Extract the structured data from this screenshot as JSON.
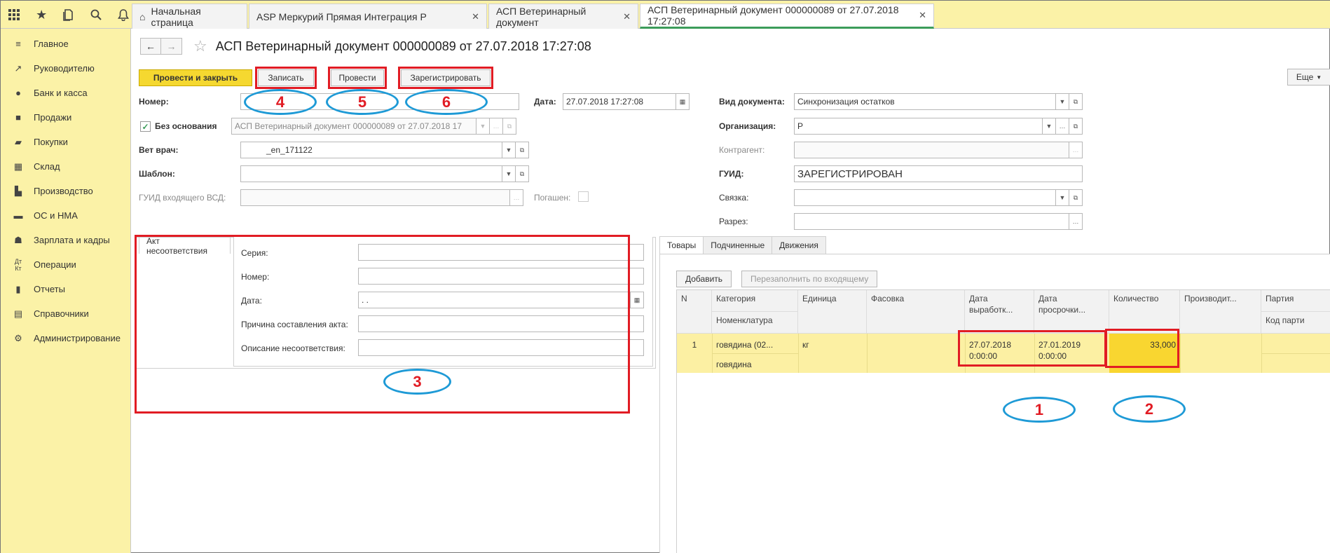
{
  "topbar": {
    "icons": [
      "apps-grid-icon",
      "star-icon",
      "history-icon",
      "search-icon",
      "bell-icon"
    ],
    "tabs": [
      {
        "label": "Начальная страница",
        "closable": false
      },
      {
        "label": "ASP Меркурий Прямая Интеграция Р",
        "closable": true
      },
      {
        "label": "АСП Ветеринарный документ",
        "closable": true
      },
      {
        "label": "АСП Ветеринарный документ 000000089 от 27.07.2018 17:27:08",
        "closable": true
      }
    ]
  },
  "sidebar": {
    "items": [
      {
        "label": "Главное",
        "icon": "menu-lines-icon"
      },
      {
        "label": "Руководителю",
        "icon": "chart-trend-icon"
      },
      {
        "label": "Банк и касса",
        "icon": "coin-icon"
      },
      {
        "label": "Продажи",
        "icon": "bag-icon"
      },
      {
        "label": "Покупки",
        "icon": "cart-icon"
      },
      {
        "label": "Склад",
        "icon": "warehouse-icon"
      },
      {
        "label": "Производство",
        "icon": "factory-icon"
      },
      {
        "label": "ОС и НМА",
        "icon": "truck-icon"
      },
      {
        "label": "Зарплата и кадры",
        "icon": "person-icon"
      },
      {
        "label": "Операции",
        "icon": "debit-credit-icon"
      },
      {
        "label": "Отчеты",
        "icon": "bar-chart-icon"
      },
      {
        "label": "Справочники",
        "icon": "book-icon"
      },
      {
        "label": "Администрирование",
        "icon": "gear-icon"
      }
    ]
  },
  "header": {
    "title": "АСП Ветеринарный документ 000000089 от 27.07.2018 17:27:08"
  },
  "toolbar": {
    "post_close": "Провести и закрыть",
    "save": "Записать",
    "post": "Провести",
    "register": "Зарегистрировать",
    "more": "Еще"
  },
  "form": {
    "number_label": "Номер:",
    "date_label": "Дата:",
    "date_value": "27.07.2018 17:27:08",
    "no_basis_label": "Без основания",
    "basis_value": "АСП Ветеринарный документ 000000089 от 27.07.2018 17",
    "vet_label": "Вет врач:",
    "vet_value": "_en_171122",
    "template_label": "Шаблон:",
    "incoming_guid_label": "ГУИД входящего ВСД:",
    "repaid_label": "Погашен:",
    "doc_type_label": "Вид документа:",
    "doc_type_value": "Синхронизация остатков",
    "org_label": "Организация:",
    "org_value": "Р",
    "contractor_label": "Контрагент:",
    "guid_label": "ГУИД:",
    "guid_value": "ЗАРЕГИСТРИРОВАН",
    "link_label": "Связка:",
    "section_label": "Разрез:"
  },
  "left_panel": {
    "tab": "Акт несоответствия",
    "series_label": "Серия:",
    "number_label": "Номер:",
    "date_label": "Дата:",
    "date_value": " .  .",
    "reason_label": "Причина составления акта:",
    "description_label": "Описание несоответствия:"
  },
  "right_panel": {
    "tabs": [
      "Товары",
      "Подчиненные",
      "Движения"
    ],
    "add_button": "Добавить",
    "refill_button": "Перезаполнить по входящему",
    "columns": {
      "n": "N",
      "category": "Категория",
      "nomenclature": "Номенклатура",
      "unit": "Единица",
      "packing": "Фасовка",
      "production_date": "Дата выработк...",
      "expiry_date": "Дата просрочки...",
      "quantity": "Количество",
      "producer": "Производит...",
      "batch": "Партия",
      "batch_code": "Код парти"
    },
    "rows": [
      {
        "n": "1",
        "category": "говядина (02...",
        "nomenclature": "говядина",
        "unit": "кг",
        "packing": "",
        "production_date": "27.07.2018 0:00:00",
        "expiry_date": "27.01.2019 0:00:00",
        "quantity": "33,000",
        "producer": "",
        "batch": ""
      }
    ]
  },
  "annotations": {
    "labels": [
      "1",
      "2",
      "3",
      "4",
      "5",
      "6"
    ],
    "red_color": "#e11c24",
    "blue_color": "#1e9ad6"
  },
  "colors": {
    "sidebar_bg": "#fbf2a7",
    "primary_button": "#f5d830",
    "selected_row": "#fcf0a3",
    "selected_cell": "#f9d630",
    "active_tab_underline": "#3c9c5a"
  }
}
